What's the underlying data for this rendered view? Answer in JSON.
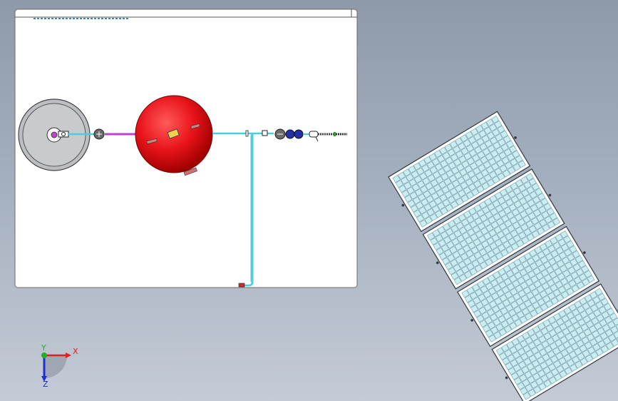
{
  "viewport": {
    "background_top": "#8e9aaa",
    "background_bottom": "#c4cbd6"
  },
  "drawing_sheet": {
    "title_block_text": "",
    "sheet_color": "#ffffff",
    "border_color": "#6b6b6b"
  },
  "scene": {
    "tank_color": "#e8141a",
    "pipe_color": "#49d0e0",
    "magenta_pipe_color": "#c040d0",
    "pump_color": "#2530a8",
    "solar_cell_color": "#c9eef2"
  },
  "triad": {
    "x_label": "X",
    "y_label": "Y",
    "z_label": "Z",
    "x_color": "#e02020",
    "y_color": "#20b020",
    "z_color": "#2030d0"
  },
  "solar_array": {
    "panel_count": 4,
    "cell_columns": 20,
    "cell_rows": 10
  }
}
